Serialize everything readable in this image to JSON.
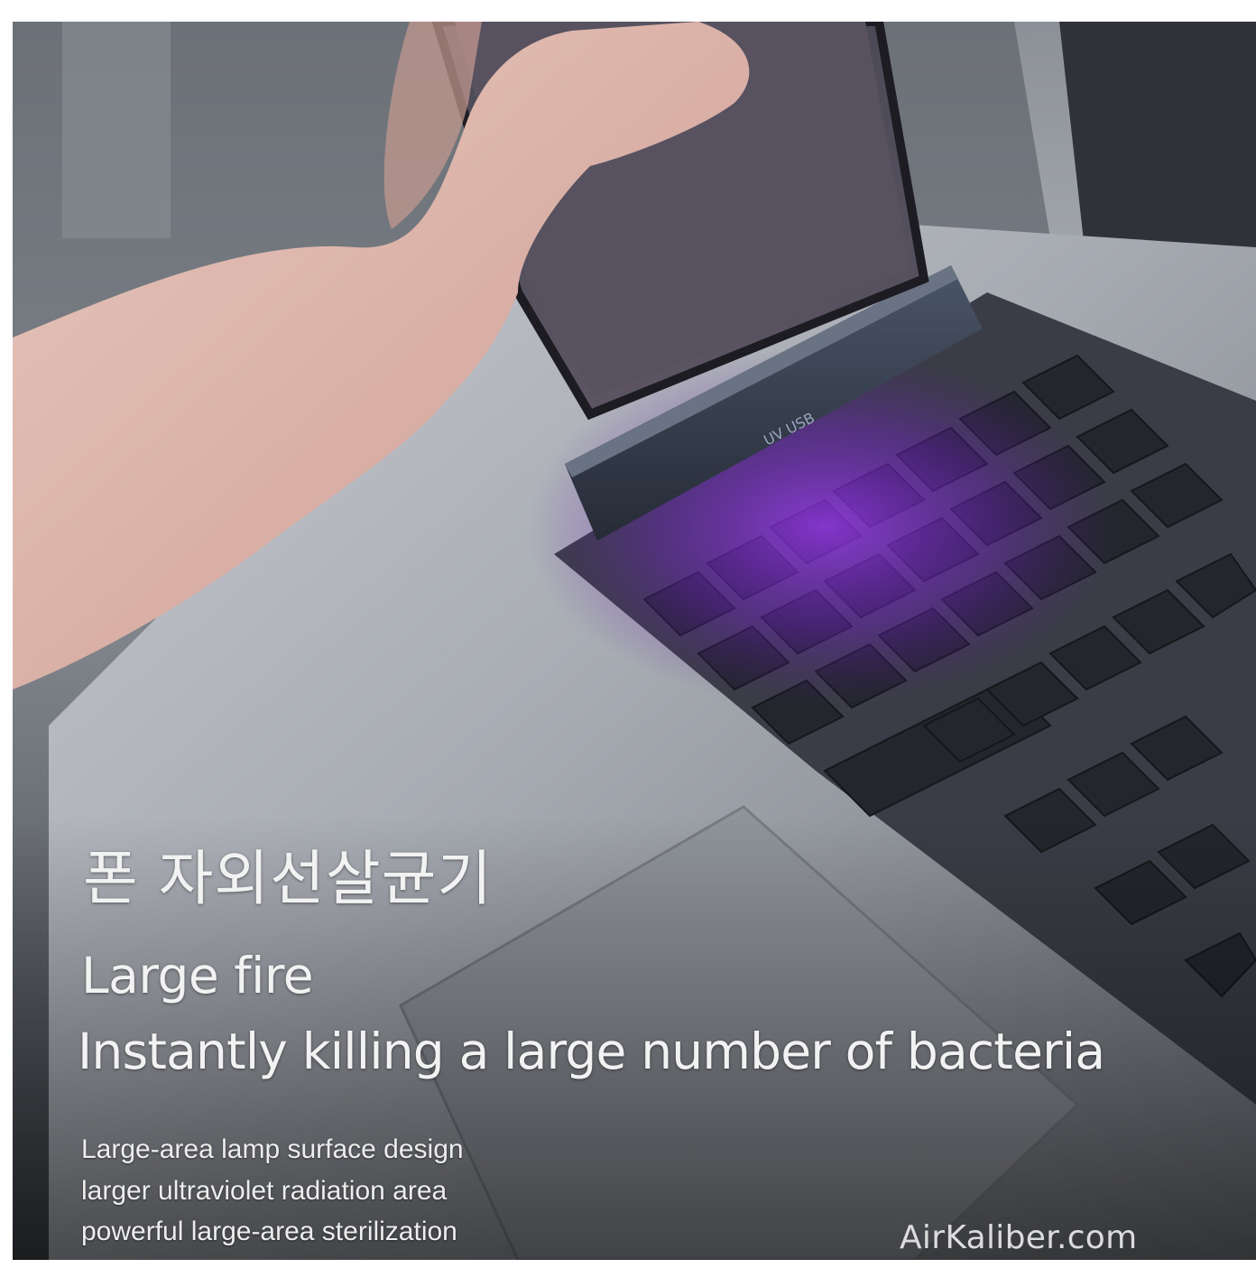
{
  "title_korean": "폰 자외선살균기",
  "headline": {
    "line1": "Large fire",
    "line2": "Instantly killing a large number of bacteria"
  },
  "features": [
    "Large-area lamp surface design",
    "larger ultraviolet radiation area",
    "powerful large-area sterilization"
  ],
  "device_label": "UV USB",
  "watermark": "AirKaliber.com",
  "colors": {
    "uv_glow": "#8a2be2",
    "laptop_silver": "#b9bcc2",
    "keyboard_keys": "#2a2d35",
    "text": "#f2f2f2"
  }
}
